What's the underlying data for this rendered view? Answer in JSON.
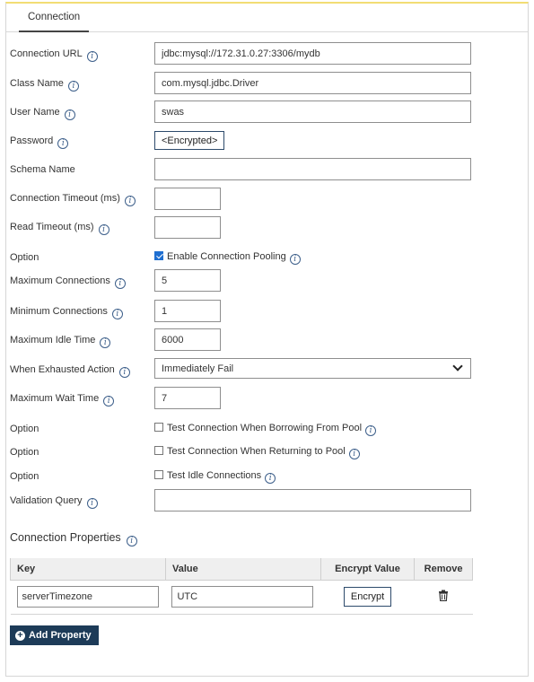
{
  "tab": {
    "label": "Connection"
  },
  "form": {
    "connection_url": {
      "label": "Connection URL",
      "value": "jdbc:mysql://172.31.0.27:3306/mydb"
    },
    "class_name": {
      "label": "Class Name",
      "value": "com.mysql.jdbc.Driver"
    },
    "user_name": {
      "label": "User Name",
      "value": "swas"
    },
    "password": {
      "label": "Password",
      "button": "<Encrypted>"
    },
    "schema_name": {
      "label": "Schema Name",
      "value": ""
    },
    "connection_timeout": {
      "label": "Connection Timeout (ms)",
      "value": ""
    },
    "read_timeout": {
      "label": "Read Timeout (ms)",
      "value": ""
    },
    "pooling": {
      "label": "Option",
      "checkbox_label": "Enable Connection Pooling",
      "checked": true
    },
    "max_connections": {
      "label": "Maximum Connections",
      "value": "5"
    },
    "min_connections": {
      "label": "Minimum Connections",
      "value": "1"
    },
    "max_idle_time": {
      "label": "Maximum Idle Time",
      "value": "6000"
    },
    "exhausted_action": {
      "label": "When Exhausted Action",
      "selected": "Immediately Fail"
    },
    "max_wait_time": {
      "label": "Maximum Wait Time",
      "value": "7"
    },
    "test_borrow": {
      "label": "Option",
      "checkbox_label": "Test Connection When Borrowing From Pool",
      "checked": false
    },
    "test_return": {
      "label": "Option",
      "checkbox_label": "Test Connection When Returning to Pool",
      "checked": false
    },
    "test_idle": {
      "label": "Option",
      "checkbox_label": "Test Idle Connections",
      "checked": false
    },
    "validation_query": {
      "label": "Validation Query",
      "value": ""
    }
  },
  "properties": {
    "title": "Connection Properties",
    "columns": {
      "key": "Key",
      "value": "Value",
      "encrypt": "Encrypt Value",
      "remove": "Remove"
    },
    "rows": [
      {
        "key": "serverTimezone",
        "value": "UTC",
        "encrypt_button": "Encrypt"
      }
    ],
    "add_button": "Add Property"
  },
  "icons": {
    "info": "info-icon",
    "remove": "trash-icon",
    "add": "plus-circle-icon",
    "dropdown": "chevron-down-icon"
  },
  "colors": {
    "accent_dark": "#1d3b58",
    "checkbox_on": "#1f6fd1",
    "top_border": "#f2dd74",
    "info_icon": "#3d5f8a"
  }
}
